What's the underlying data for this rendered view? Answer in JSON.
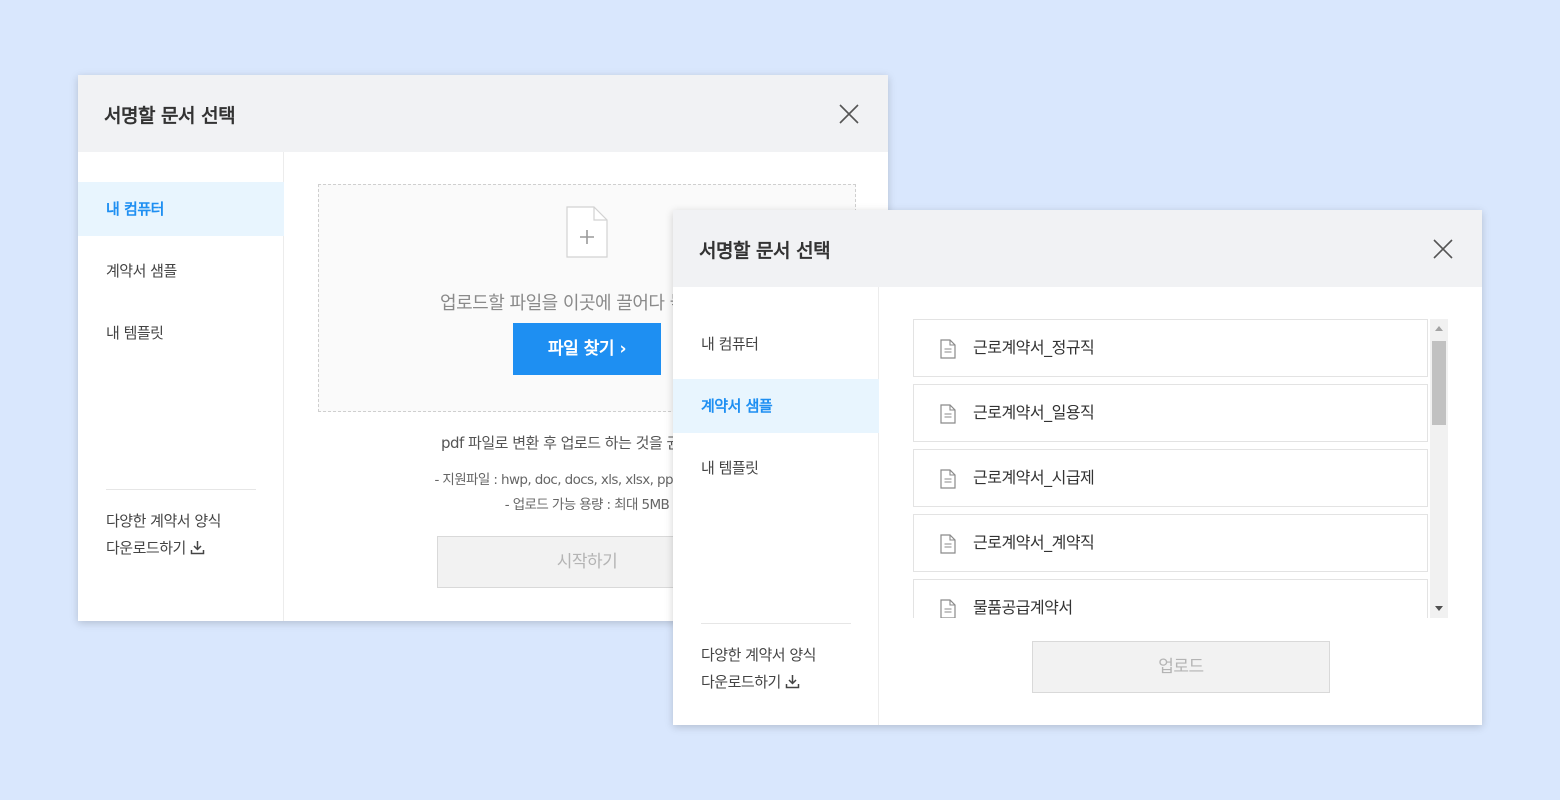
{
  "dialog_back": {
    "title": "서명할 문서 선택",
    "sidebar": {
      "items": [
        {
          "label": "내 컴퓨터",
          "active": true
        },
        {
          "label": "계약서 샘플",
          "active": false
        },
        {
          "label": "내 템플릿",
          "active": false
        }
      ],
      "download_line1": "다양한 계약서 양식",
      "download_line2": "다운로드하기"
    },
    "dropzone": {
      "text": "업로드할 파일을 이곳에 끌어다 놓으세요",
      "find_button": "파일 찾기 ›"
    },
    "note": "pdf 파일로 변환 후 업로드 하는 것을 권장합니다",
    "supported_files": "- 지원파일 : hwp, doc, docs, xls, xlsx, ppt, ppts, pdf",
    "max_size": "- 업로드 가능 용량 : 최대 5MB",
    "start_button": "시작하기"
  },
  "dialog_front": {
    "title": "서명할 문서 선택",
    "sidebar": {
      "items": [
        {
          "label": "내 컴퓨터",
          "active": false
        },
        {
          "label": "계약서 샘플",
          "active": true
        },
        {
          "label": "내 템플릿",
          "active": false
        }
      ],
      "download_line1": "다양한 계약서 양식",
      "download_line2": "다운로드하기"
    },
    "files": [
      "근로계약서_정규직",
      "근로계약서_일용직",
      "근로계약서_시급제",
      "근로계약서_계약직",
      "물품공급계약서"
    ],
    "upload_button": "업로드"
  },
  "colors": {
    "background": "#d9e7fd",
    "accent": "#1e8ff2",
    "active_item_bg": "#e8f5fe",
    "header_bg": "#f1f2f4"
  },
  "icons": [
    "close-icon",
    "file-plus-icon",
    "download-icon",
    "document-icon",
    "scroll-up-arrow-icon",
    "scroll-down-arrow-icon"
  ]
}
